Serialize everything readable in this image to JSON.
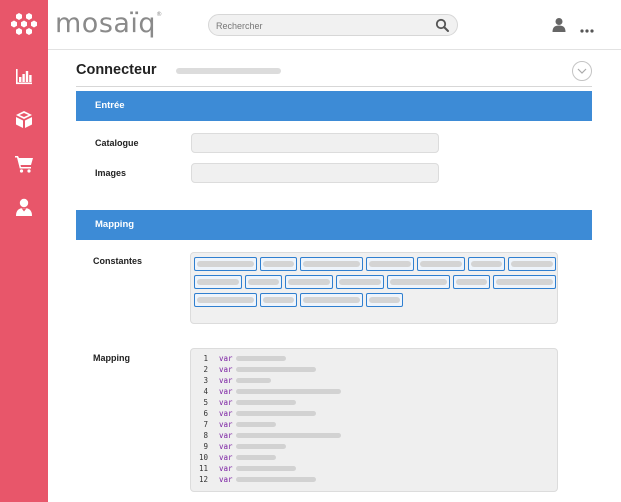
{
  "header": {
    "brand": "mosaïq",
    "brand_mark": "®",
    "search_placeholder": "Rechercher"
  },
  "sidebar": {
    "items": [
      {
        "id": "logo",
        "icon": "hexagon-logo-icon"
      },
      {
        "id": "statistics",
        "icon": "bar-chart-icon"
      },
      {
        "id": "catalog",
        "icon": "box-icon"
      },
      {
        "id": "cart",
        "icon": "cart-icon"
      },
      {
        "id": "users",
        "icon": "user-icon"
      }
    ]
  },
  "page": {
    "title": "Connecteur"
  },
  "sections": {
    "input": {
      "header": "Entrée",
      "catalog_label": "Catalogue",
      "catalog_value": "",
      "images_label": "Images",
      "images_value": ""
    },
    "mapping": {
      "header": "Mapping",
      "constants_label": "Constantes",
      "mapping_label": "Mapping"
    }
  },
  "constants_chip_rows": [
    {
      "count": 8
    },
    {
      "count": 7
    },
    {
      "count": 4
    }
  ],
  "code": {
    "keyword": "var",
    "lines": [
      {
        "n": "1",
        "kw": "var"
      },
      {
        "n": "2",
        "kw": "var"
      },
      {
        "n": "3",
        "kw": "var"
      },
      {
        "n": "4",
        "kw": "var"
      },
      {
        "n": "5",
        "kw": "var"
      },
      {
        "n": "6",
        "kw": "var"
      },
      {
        "n": "7",
        "kw": "var"
      },
      {
        "n": "8",
        "kw": "var"
      },
      {
        "n": "9",
        "kw": "var"
      },
      {
        "n": "10",
        "kw": "var"
      },
      {
        "n": "11",
        "kw": "var"
      },
      {
        "n": "12",
        "kw": "var"
      }
    ]
  },
  "colors": {
    "sidebar": "#e8566a",
    "section_header": "#3d8bd6",
    "keyword": "#7a1fa2"
  }
}
